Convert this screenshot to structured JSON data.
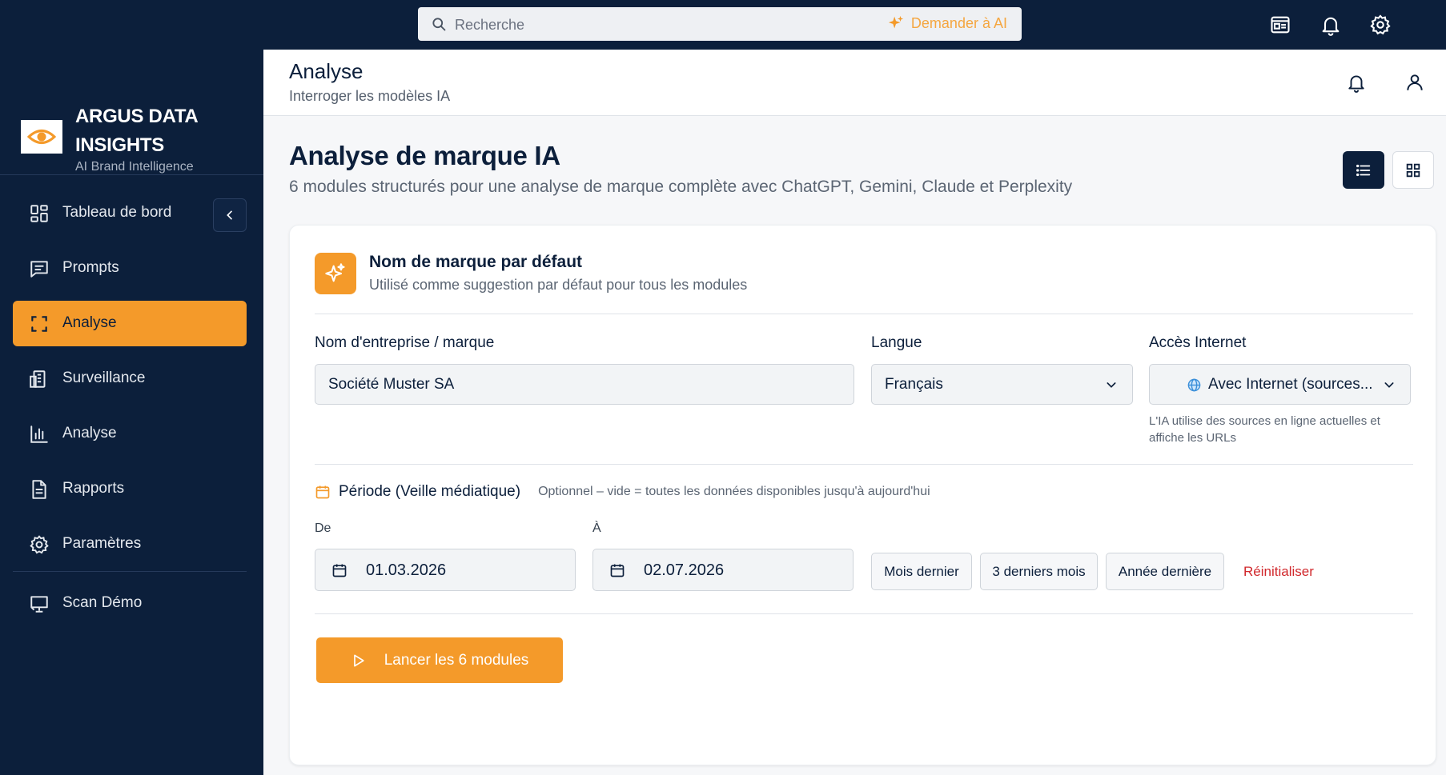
{
  "topbar": {
    "search_placeholder": "Recherche",
    "ask_ai": "Demander à AI",
    "icons": [
      "news-icon",
      "bell-icon",
      "gear-icon"
    ]
  },
  "brand": {
    "name": "ARGUS DATA INSIGHTS",
    "tagline": "AI Brand Intelligence",
    "accent": "#f49a2a"
  },
  "sidebar": {
    "items": [
      {
        "label": "Tableau de bord",
        "icon": "dashboard-icon"
      },
      {
        "label": "Prompts",
        "icon": "message-icon"
      },
      {
        "label": "Analyse",
        "icon": "scan-icon",
        "active": true
      },
      {
        "label": "Surveillance",
        "icon": "monitor-icon"
      },
      {
        "label": "Analyse",
        "icon": "bar-chart-icon"
      },
      {
        "label": "Rapports",
        "icon": "document-icon"
      },
      {
        "label": "Paramètres",
        "icon": "gear-icon"
      },
      {
        "label": "Scan Démo",
        "icon": "presentation-icon"
      }
    ]
  },
  "header": {
    "title": "Analyse",
    "subtitle": "Interroger les modèles IA"
  },
  "page": {
    "title": "Analyse de marque IA",
    "subtitle": "6 modules structurés pour une analyse de marque complète avec ChatGPT, Gemini, Claude et Perplexity"
  },
  "card": {
    "title": "Nom de marque par défaut",
    "subtitle": "Utilisé comme suggestion par défaut pour tous les modules",
    "company_label": "Nom d'entreprise / marque",
    "company_value": "Société Muster SA",
    "language_label": "Langue",
    "language_value": "Français",
    "internet_label": "Accès Internet",
    "internet_value": "Avec Internet (sources...",
    "internet_hint": "L'IA utilise des sources en ligne actuelles et affiche les URLs",
    "period_label": "Période (Veille médiatique)",
    "period_hint": "Optionnel – vide = toutes les données disponibles jusqu'à aujourd'hui",
    "from_label": "De",
    "from_value": "01.03.2026",
    "to_label": "À",
    "to_value": "02.07.2026",
    "quick_buttons": [
      "Mois dernier",
      "3 derniers mois",
      "Année dernière"
    ],
    "reset_label": "Réinitialiser",
    "run_label": "Lancer les 6 modules"
  }
}
